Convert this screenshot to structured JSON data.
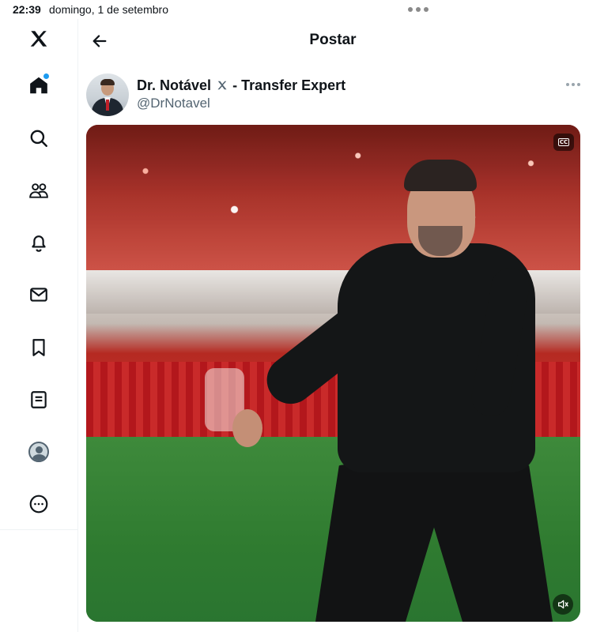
{
  "status_bar": {
    "time": "22:39",
    "date": "domingo, 1 de setembro"
  },
  "sidebar": {
    "items": [
      {
        "name": "logo",
        "icon": "x-logo-icon"
      },
      {
        "name": "home",
        "icon": "home-icon",
        "has_notification_dot": true
      },
      {
        "name": "explore",
        "icon": "search-icon"
      },
      {
        "name": "communities",
        "icon": "communities-icon"
      },
      {
        "name": "notifications",
        "icon": "bell-icon"
      },
      {
        "name": "messages",
        "icon": "envelope-icon"
      },
      {
        "name": "bookmarks",
        "icon": "bookmark-icon"
      },
      {
        "name": "lists",
        "icon": "lists-icon"
      },
      {
        "name": "profile",
        "icon": "profile-avatar-icon"
      },
      {
        "name": "more",
        "icon": "more-circle-icon"
      }
    ]
  },
  "header": {
    "title": "Postar"
  },
  "post": {
    "author_name": "Dr. Notável",
    "author_suffix": "- Transfer Expert",
    "author_handle": "@DrNotavel"
  },
  "video": {
    "cc_label": "CC"
  },
  "colors": {
    "accent": "#1d9bf0",
    "text_primary": "#0f1419",
    "text_secondary": "#536471"
  }
}
